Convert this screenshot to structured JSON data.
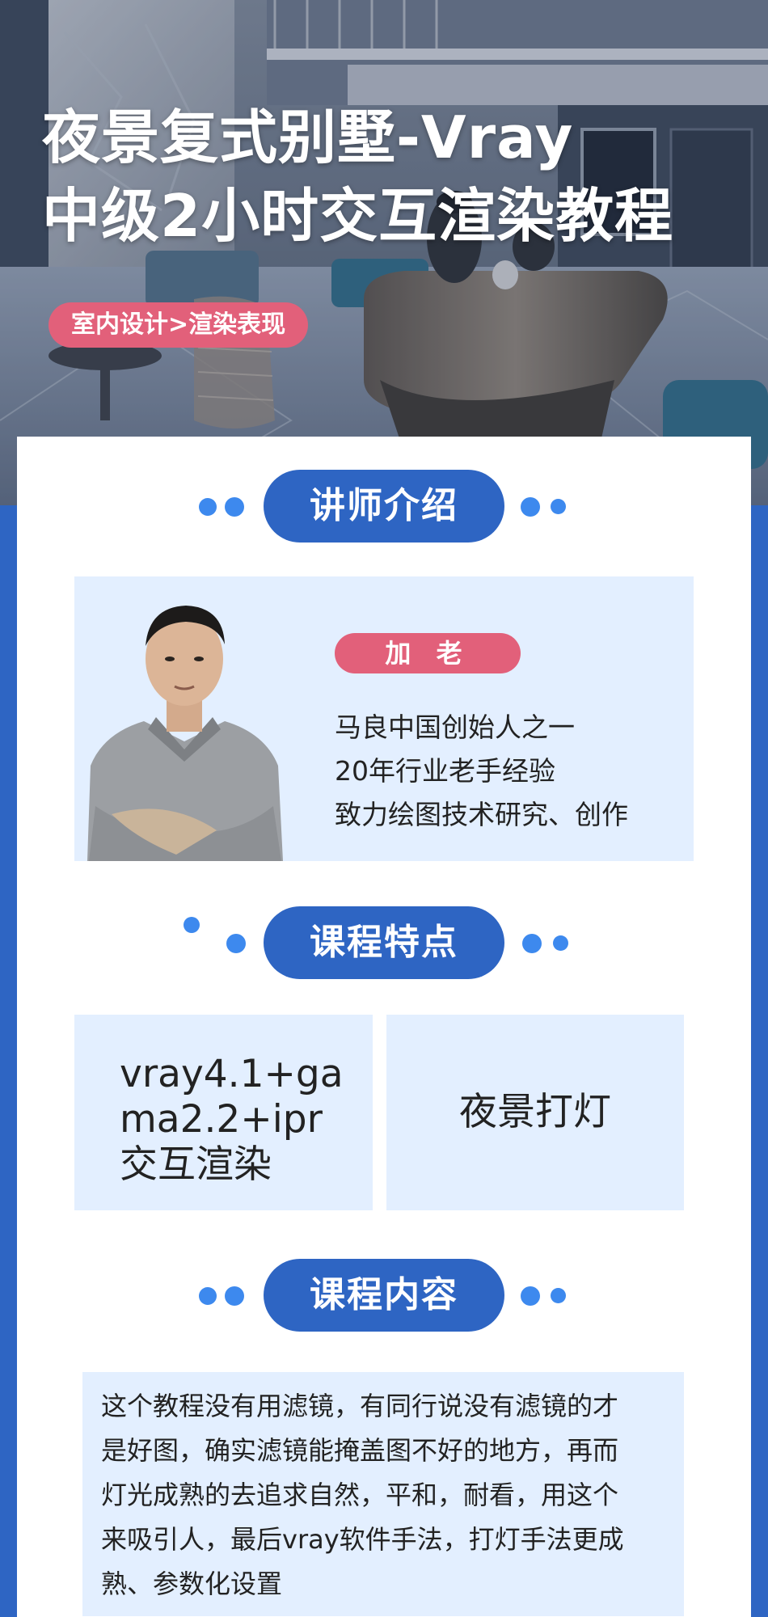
{
  "hero": {
    "title_line1": "夜景复式别墅-Vray",
    "title_line2": "中级2小时交互渲染教程",
    "tag": "室内设计>渲染表现"
  },
  "sections": {
    "teacher": "讲师介绍",
    "features": "课程特点",
    "content": "课程内容"
  },
  "teacher": {
    "name": "加 老",
    "bio": [
      "马良中国创始人之一",
      "20年行业老手经验",
      "致力绘图技术研究、创作"
    ]
  },
  "features": {
    "item1_lines": [
      "vray4.1+ga",
      "ma2.2+ipr",
      "交互渲染"
    ],
    "item2": "夜景打灯"
  },
  "content": {
    "lines": [
      "这个教程没有用滤镜，有同行说没有滤镜的才",
      "是好图，确实滤镜能掩盖图不好的地方，再而",
      "灯光成熟的去追求自然，平和，耐看，用这个",
      "来吸引人，最后vray软件手法，打灯手法更成",
      "熟、参数化设置"
    ]
  },
  "colors": {
    "brand_blue": "#2e65c3",
    "accent_pink": "#e2607a",
    "panel_blue": "#e3efff",
    "dot_blue": "#3d89ee"
  }
}
